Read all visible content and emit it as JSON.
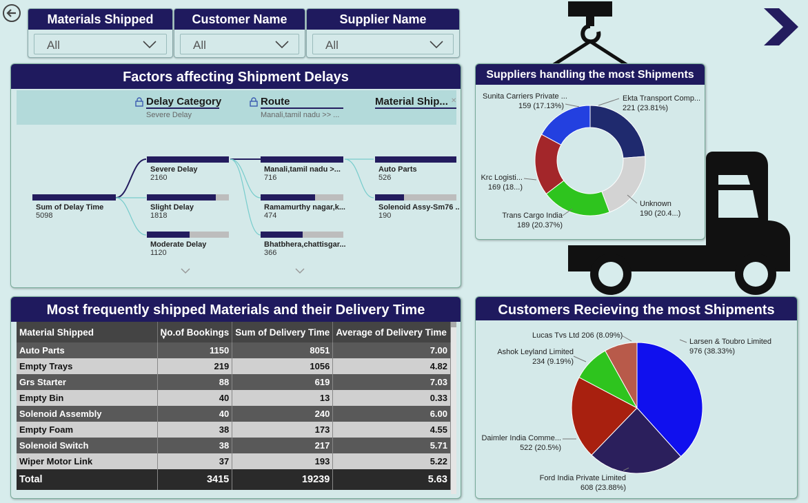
{
  "slicers": [
    {
      "header": "Materials Shipped",
      "value": "All"
    },
    {
      "header": "Customer Name",
      "value": "All"
    },
    {
      "header": "Supplier Name",
      "value": "All"
    }
  ],
  "decomp": {
    "title": "Factors affecting Shipment Delays",
    "levels": [
      {
        "name": "Delay Category",
        "filter": "Severe Delay"
      },
      {
        "name": "Route",
        "filter": "Manali,tamil nadu >> ..."
      },
      {
        "name": "Material Ship..."
      }
    ],
    "root": {
      "label": "Sum of Delay Time",
      "value": "5098"
    },
    "col1": [
      {
        "label": "Severe Delay",
        "value": "2160"
      },
      {
        "label": "Slight Delay",
        "value": "1818"
      },
      {
        "label": "Moderate Delay",
        "value": "1120"
      }
    ],
    "col2": [
      {
        "label": "Manali,tamil nadu >...",
        "value": "716"
      },
      {
        "label": "Ramamurthy nagar,k...",
        "value": "474"
      },
      {
        "label": "Bhatbhera,chattisgar...",
        "value": "366"
      }
    ],
    "col3": [
      {
        "label": "Auto Parts",
        "value": "526"
      },
      {
        "label": "Solenoid Assy-Sm76 ..",
        "value": "190"
      }
    ]
  },
  "suppliers": {
    "title": "Suppliers handling the most Shipments",
    "labels": {
      "ekta": [
        "Ekta Transport Comp...",
        "221 (23.81%)"
      ],
      "sunita": [
        "Sunita Carriers Private ...",
        "159 (17.13%)"
      ],
      "krc": [
        "Krc Logisti...",
        "169 (18...)"
      ],
      "trans": [
        "Trans Cargo India",
        "189 (20.37%)"
      ],
      "unknown": [
        "Unknown",
        "190 (20.4...)"
      ]
    }
  },
  "materials": {
    "title": "Most frequently shipped Materials and their Delivery Time",
    "headers": [
      "Material Shipped",
      "No.of Bookings",
      "Sum of Delivery Time",
      "Average of Delivery Time"
    ],
    "rows": [
      [
        "Auto Parts",
        "1150",
        "8051",
        "7.00"
      ],
      [
        "Empty Trays",
        "219",
        "1056",
        "4.82"
      ],
      [
        "Grs Starter",
        "88",
        "619",
        "7.03"
      ],
      [
        "Empty Bin",
        "40",
        "13",
        "0.33"
      ],
      [
        "Solenoid Assembly",
        "40",
        "240",
        "6.00"
      ],
      [
        "Empty Foam",
        "38",
        "173",
        "4.55"
      ],
      [
        "Solenoid Switch",
        "38",
        "217",
        "5.71"
      ],
      [
        "Wiper Motor Link",
        "37",
        "193",
        "5.22"
      ]
    ],
    "total": [
      "Total",
      "3415",
      "19239",
      "5.63"
    ]
  },
  "customers": {
    "title": "Customers Recieving the most Shipments",
    "labels": {
      "larsen": [
        "Larsen & Toubro Limited",
        "976 (38.33%)"
      ],
      "lucas": [
        "Lucas Tvs Ltd 206 (8.09%)"
      ],
      "ashok": [
        "Ashok Leyland Limited",
        "234 (9.19%)"
      ],
      "daimler": [
        "Daimler India Comme...",
        "522 (20.5%)"
      ],
      "ford": [
        "Ford India Private Limited",
        "608 (23.88%)"
      ]
    }
  },
  "chart_data": [
    {
      "type": "pie",
      "title": "Suppliers handling the most Shipments",
      "categories": [
        "Ekta Transport Comp...",
        "Unknown",
        "Trans Cargo India",
        "Krc Logisti...",
        "Sunita Carriers Private ..."
      ],
      "values": [
        221,
        190,
        189,
        169,
        159
      ],
      "colors": [
        "#1f2a6e",
        "#d3d3d3",
        "#2ec41e",
        "#a3262a",
        "#2340e0"
      ]
    },
    {
      "type": "pie",
      "title": "Customers Recieving the most Shipments",
      "categories": [
        "Larsen & Toubro Limited",
        "Ford India Private Limited",
        "Daimler India Comme...",
        "Ashok Leyland Limited",
        "Lucas Tvs Ltd"
      ],
      "values": [
        976,
        608,
        522,
        234,
        206
      ],
      "colors": [
        "#1010ee",
        "#2b1f5c",
        "#a8200f",
        "#2ec41e",
        "#b85a4a"
      ]
    }
  ]
}
